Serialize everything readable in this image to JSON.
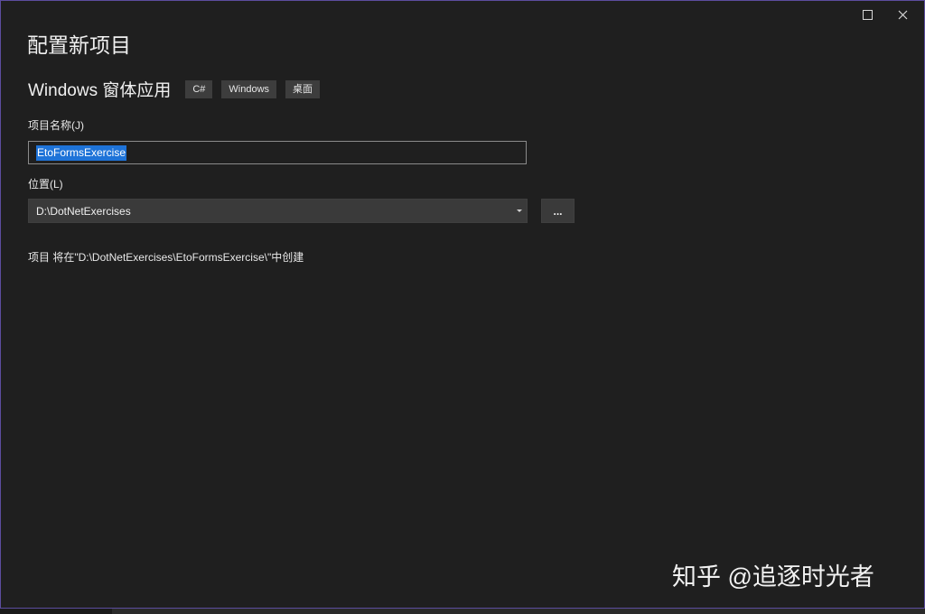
{
  "window": {
    "title": "配置新项目"
  },
  "template": {
    "name": "Windows 窗体应用",
    "tags": [
      "C#",
      "Windows",
      "桌面"
    ]
  },
  "project_name": {
    "label": "项目名称(J)",
    "value": "EtoFormsExercise"
  },
  "location": {
    "label": "位置(L)",
    "value": "D:\\DotNetExercises",
    "browse_label": "..."
  },
  "path_info": "项目 将在\"D:\\DotNetExercises\\EtoFormsExercise\\\"中创建",
  "watermark": "知乎 @追逐时光者",
  "icons": {
    "maximize": "maximize-icon",
    "close": "close-icon",
    "dropdown": "chevron-down-icon"
  },
  "colors": {
    "background": "#1f1f1f",
    "accent_border": "#5c4d9e",
    "selection": "#1e73d8"
  }
}
